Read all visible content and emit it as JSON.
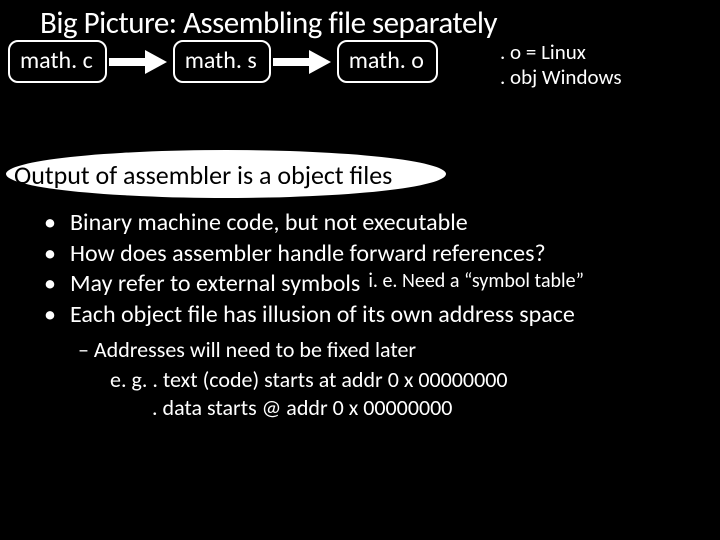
{
  "title": "Big Picture: Assembling file separately",
  "flow": {
    "box1": "math. c",
    "box2": "math. s",
    "box3": "math. o"
  },
  "sidenote": {
    "l1": ". o = Linux",
    "l2": ". obj Windows"
  },
  "subhead": "Output of assembler is a object files",
  "bullets": {
    "b1": "Binary machine code, but not executable",
    "b2": "How does assembler handle forward references?",
    "b3": "May refer to external symbols",
    "b3n": "i. e. Need a “symbol table”",
    "b4": "Each object file has illusion of its own address space"
  },
  "sub": "– Addresses will need to be fixed later",
  "sub2": "e. g. . text (code) starts at addr 0 x 00000000",
  "sub3": ". data starts @ addr 0 x 00000000"
}
